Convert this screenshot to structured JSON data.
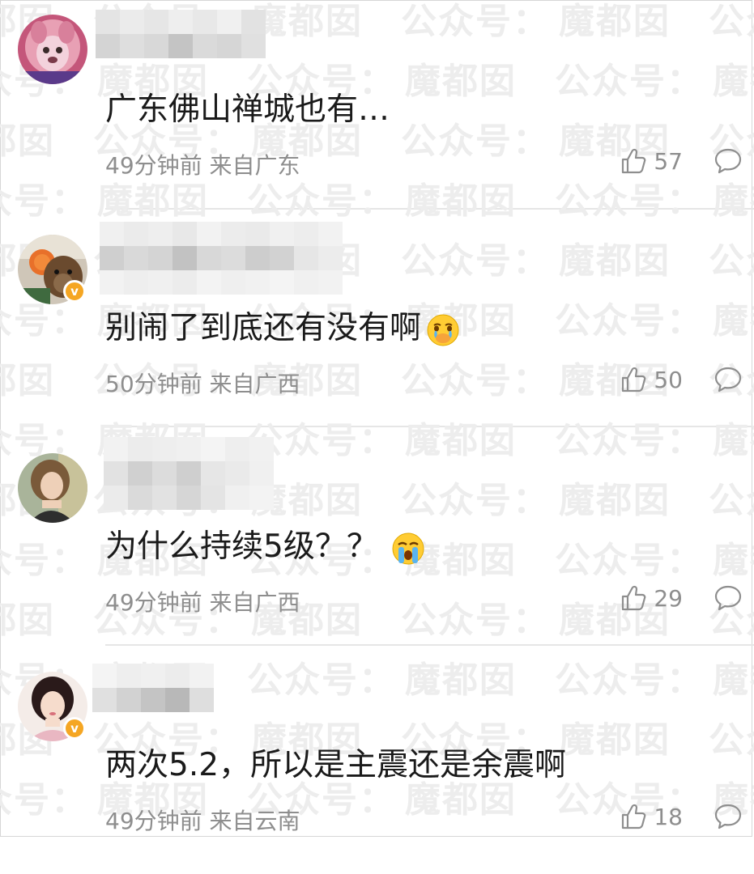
{
  "watermark": {
    "text_a": "公众号：",
    "text_b": "魔都囡"
  },
  "comments": [
    {
      "text": "广东佛山禅城也有…",
      "time": "49分钟前",
      "location": "来自广东",
      "likes": "57",
      "verified": false,
      "emoji": ""
    },
    {
      "text": "别闹了到底还有没有啊",
      "time": "50分钟前",
      "location": "来自广西",
      "likes": "50",
      "verified": true,
      "emoji": "tearful-hand-over-mouth-emoji"
    },
    {
      "text": "为什么持续5级？？",
      "time": "49分钟前",
      "location": "来自广西",
      "likes": "29",
      "verified": false,
      "emoji": "crying-emoji"
    },
    {
      "text": "两次5.2，所以是主震还是余震啊",
      "time": "49分钟前",
      "location": "来自云南",
      "likes": "18",
      "verified": true,
      "emoji": ""
    }
  ],
  "colors": {
    "badge": "#f5a623",
    "meta_text": "#8e8e8e",
    "body_text": "#1a1a1a",
    "divider": "#e6e6e6"
  }
}
